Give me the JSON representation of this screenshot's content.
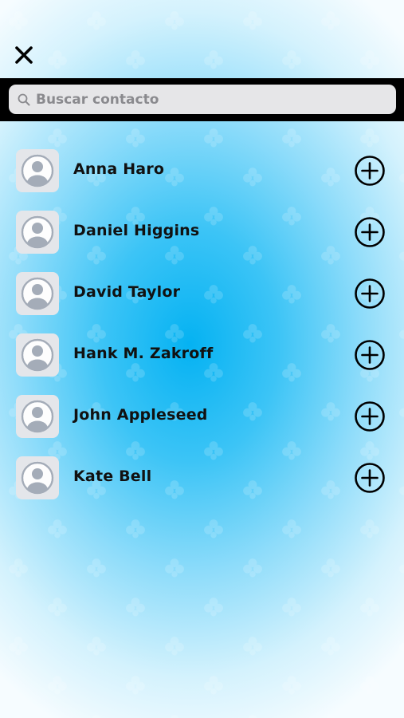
{
  "header": {
    "close_icon": "close-x-icon"
  },
  "search": {
    "placeholder": "Buscar contacto",
    "value": "",
    "icon": "search-icon"
  },
  "contacts": [
    {
      "name": "Anna Haro",
      "avatar_icon": "person-placeholder-icon",
      "action_icon": "add-circle-icon"
    },
    {
      "name": "Daniel Higgins",
      "avatar_icon": "person-placeholder-icon",
      "action_icon": "add-circle-icon"
    },
    {
      "name": "David Taylor",
      "avatar_icon": "person-placeholder-icon",
      "action_icon": "add-circle-icon"
    },
    {
      "name": "Hank M. Zakroff",
      "avatar_icon": "person-placeholder-icon",
      "action_icon": "add-circle-icon"
    },
    {
      "name": "John Appleseed",
      "avatar_icon": "person-placeholder-icon",
      "action_icon": "add-circle-icon"
    },
    {
      "name": "Kate Bell",
      "avatar_icon": "person-placeholder-icon",
      "action_icon": "add-circle-icon"
    }
  ],
  "colors": {
    "background_center": "#05b2f2",
    "background_edge": "#f6fcff",
    "search_bar": "#000000",
    "search_box": "#e6e6e8",
    "text": "#111111"
  }
}
